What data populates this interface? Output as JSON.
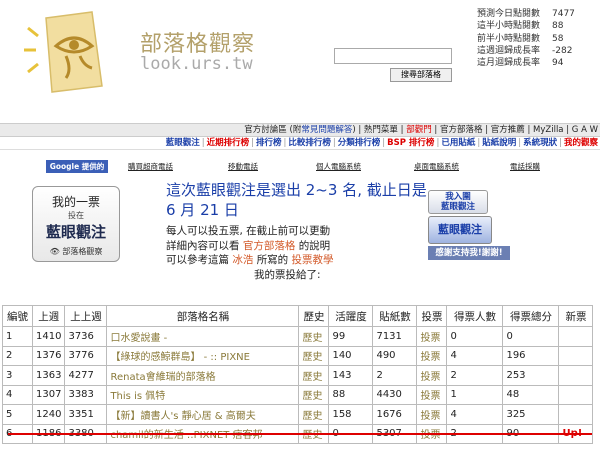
{
  "header": {
    "site_title": "部落格觀察",
    "site_url": "look.urs.tw",
    "search_button": "搜尋部落格",
    "search_value": ""
  },
  "stats": [
    {
      "label": "預測今日點閱數",
      "value": "7477"
    },
    {
      "label": "這半小時點閱數",
      "value": "88"
    },
    {
      "label": "前半小時點閱數",
      "value": "58"
    },
    {
      "label": "這週迴歸成長率",
      "value": "-282"
    },
    {
      "label": "這月迴歸成長率",
      "value": "94"
    }
  ],
  "nav1": {
    "part1": "官方討論區 (附",
    "faq": "常見問題解答",
    "part2": ") | 熱門菜單 |",
    "hot": "部觀門",
    "part3": "| 官方部落格 | 官方推薦 |",
    "myzilla": "MyZilla",
    "part4": "| G A W"
  },
  "nav2": [
    {
      "label": "藍眼觀注",
      "cls": "blue"
    },
    {
      "label": "近期排行榜",
      "cls": "red"
    },
    {
      "label": "排行榜",
      "cls": "blue"
    },
    {
      "label": "比較排行榜",
      "cls": "blue"
    },
    {
      "label": "分類排行榜",
      "cls": "blue"
    },
    {
      "label": "BSP 排行榜",
      "cls": "red"
    },
    {
      "label": "已用貼紙",
      "cls": "blue"
    },
    {
      "label": "貼紙說明",
      "cls": "blue"
    },
    {
      "label": "系統現狀",
      "cls": "blue"
    },
    {
      "label": "我的觀察",
      "cls": "red"
    }
  ],
  "ads": {
    "label": "Google 提供的廣告",
    "links": [
      "購買超商電話",
      "移動電話",
      "個人電腦系統",
      "桌面電腦系統",
      "電話採購"
    ]
  },
  "banner": {
    "line1": "我的一票",
    "line2": "投在",
    "line3": "藍眼觀注",
    "line4": "部落格觀察"
  },
  "message": {
    "title": "這次藍眼觀注是選出 2~3 名, 截止日是 6 月 21 日",
    "l1": "每人可以投五票, 在截止前可以更動",
    "l2a": "詳細內容可以看",
    "l2b": "官方部落格",
    "l2c": "的說明",
    "l3a": "可以參考這篇",
    "l3b": "冰浩",
    "l3c": "所寫的",
    "l3d": "投票教學",
    "l4": "我的票投給了:"
  },
  "buttons": {
    "join": "我入圍\n藍眼觀注",
    "vote": "藍眼觀注",
    "support": "感謝支持我!謝謝!"
  },
  "table": {
    "headers": [
      "編號",
      "上週",
      "上上週",
      "部落格名稱",
      "歷史",
      "活躍度",
      "貼紙數",
      "投票",
      "得票人數",
      "得票總分",
      "新票"
    ],
    "rows": [
      [
        "1",
        "1410",
        "3736",
        "口水愛說畫 -",
        "歷史",
        "99",
        "7131",
        "投票",
        "0",
        "0",
        ""
      ],
      [
        "2",
        "1376",
        "3776",
        "【綠球的感鯨群島】 - :: PIXNE",
        "歷史",
        "140",
        "490",
        "投票",
        "4",
        "196",
        ""
      ],
      [
        "3",
        "1363",
        "4277",
        "Renata會維瑞的部落格",
        "歷史",
        "143",
        "2",
        "投票",
        "2",
        "253",
        ""
      ],
      [
        "4",
        "1307",
        "3383",
        "This is 佩特",
        "歷史",
        "88",
        "4430",
        "投票",
        "1",
        "48",
        ""
      ],
      [
        "5",
        "1240",
        "3351",
        "【新】讀書人's 靜心居 & 高爾夫",
        "歷史",
        "158",
        "1676",
        "投票",
        "4",
        "325",
        ""
      ],
      [
        "6",
        "1186",
        "3380",
        "chamil的新生活 ::PIXNET 痞客邦",
        "歷史",
        "0",
        "5307",
        "投票",
        "2",
        "90",
        "Up!"
      ]
    ]
  }
}
